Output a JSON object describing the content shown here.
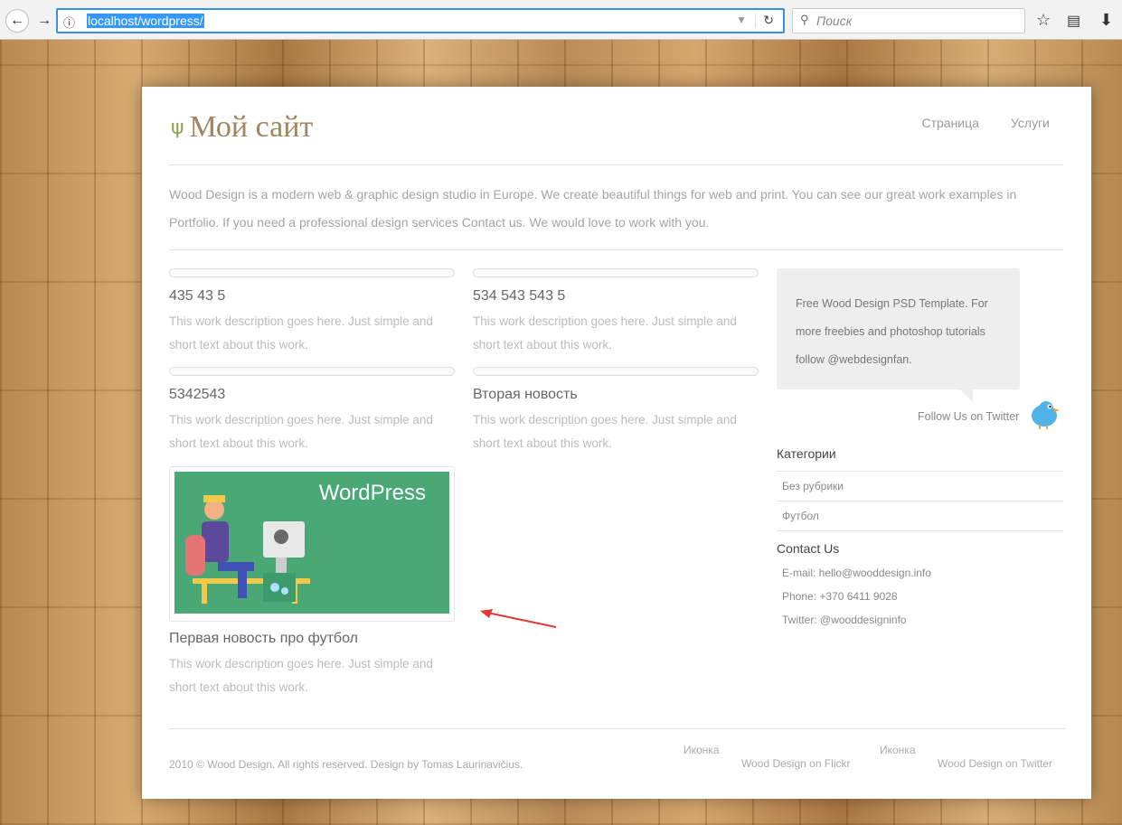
{
  "browser": {
    "url": "localhost/wordpress/",
    "search_placeholder": "Поиск"
  },
  "site": {
    "title": "Мой сайт",
    "menu": [
      "Страница",
      "Услуги"
    ],
    "intro": "Wood Design is a modern web & graphic design studio in Europe. We create beautiful things for web and print. You can see our great work examples in Portfolio. If you need a professional design services Contact us. We would love to work with you."
  },
  "posts": [
    {
      "title": "435 43 5",
      "desc": "This work description goes here. Just simple and short text about this work."
    },
    {
      "title": "534 543 543 5",
      "desc": "This work description goes here. Just simple and short text about this work."
    },
    {
      "title": "5342543",
      "desc": "This work description goes here. Just simple and short text about this work."
    },
    {
      "title": "Вторая новость",
      "desc": "This work description goes here. Just simple and short text about this work."
    },
    {
      "title": "Первая новость про футбол",
      "desc": "This work description goes here. Just simple and short text about this work.",
      "image_text": "WordPress"
    }
  ],
  "sidebar": {
    "tweet": "Free Wood Design PSD Template. For more freebies and photoshop tutorials follow @webdesignfan.",
    "follow": "Follow Us on Twitter",
    "categories_title": "Категории",
    "categories": [
      "Без рубрики",
      "Футбол"
    ],
    "contact_title": "Contact Us",
    "contact": [
      "E-mail: hello@wooddesign.info",
      "Phone: +370 6411 9028",
      "Twitter: @wooddesigninfo"
    ]
  },
  "footer": {
    "copyright": "2010 © Wood Design. All rights reserved. Design by Tomas Laurinavičius.",
    "icon_label_1": "Иконка",
    "flickr": "Wood Design on Flickr",
    "icon_label_2": "Иконка",
    "twitter": "Wood Design on Twitter"
  },
  "colors": {
    "url_highlight": "#3399ff",
    "title": "#a2845f",
    "annotation_arrow": "#e53935"
  }
}
